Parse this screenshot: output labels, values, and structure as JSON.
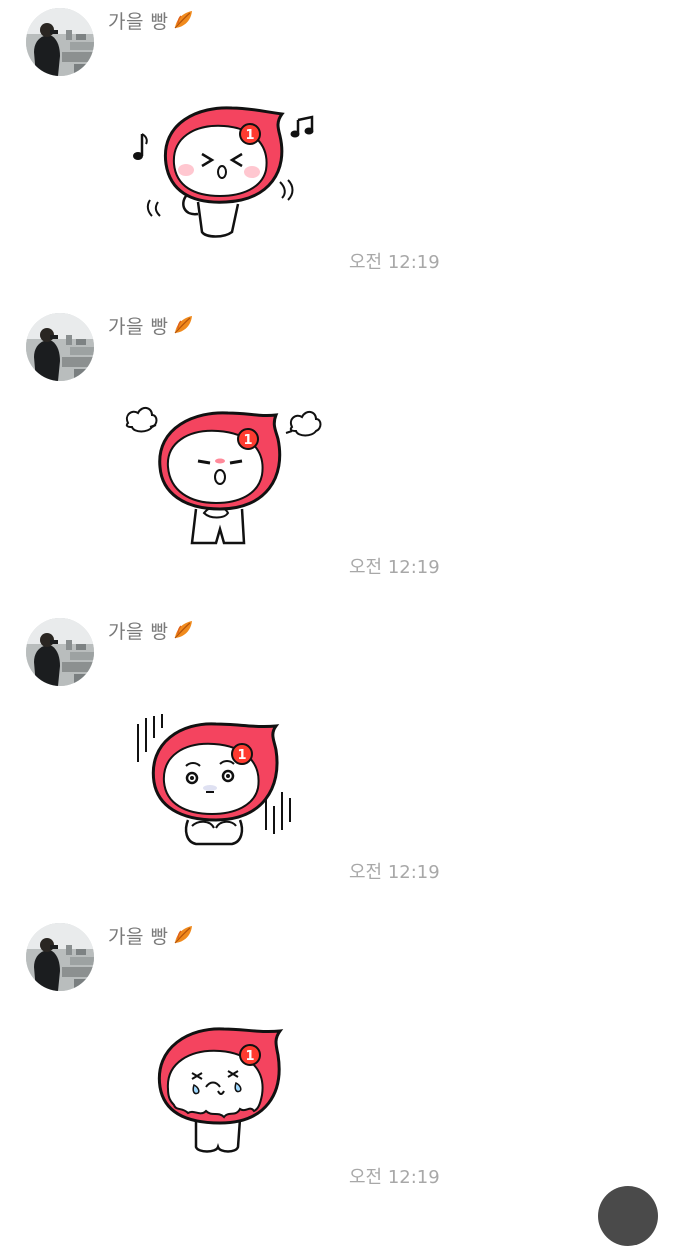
{
  "messages": [
    {
      "sender": "가을 빵",
      "sender_icon": "autumn-leaf-icon",
      "sticker": "sticker-dancing",
      "time": "오전 12:19"
    },
    {
      "sender": "가을 빵",
      "sender_icon": "autumn-leaf-icon",
      "sticker": "sticker-angry",
      "time": "오전 12:19"
    },
    {
      "sender": "가을 빵",
      "sender_icon": "autumn-leaf-icon",
      "sticker": "sticker-gloomy",
      "time": "오전 12:19"
    },
    {
      "sender": "가을 빵",
      "sender_icon": "autumn-leaf-icon",
      "sticker": "sticker-crying",
      "time": "오전 12:19"
    }
  ],
  "sticker_badge": "1",
  "colors": {
    "hood": "#f4445f",
    "badge": "#ff3b30",
    "timestamp": "#a8a8a8",
    "sender": "#7a7a7a"
  }
}
